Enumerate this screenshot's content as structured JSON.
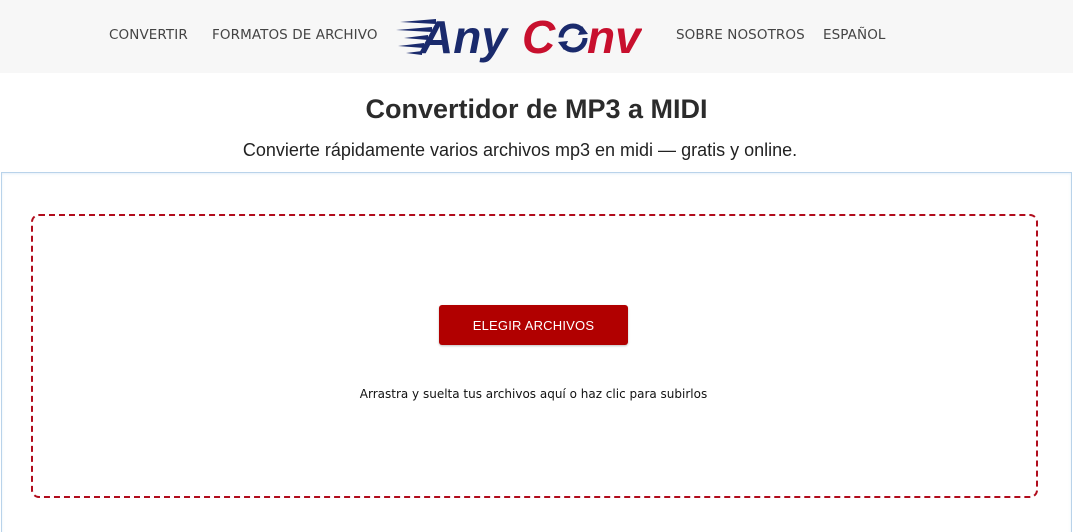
{
  "nav": {
    "convert": "CONVERTIR",
    "formats": "FORMATOS DE ARCHIVO",
    "about": "SOBRE NOSOTROS",
    "language": "ESPAÑOL"
  },
  "logo": {
    "text_any": "Any",
    "text_c": "C",
    "text_nv": "nv",
    "color_blue": "#1a2a6c",
    "color_red": "#c8102e"
  },
  "main": {
    "title": "Convertidor de MP3 a MIDI",
    "subtitle": "Convierte rápidamente varios archivos mp3 en midi — gratis y online."
  },
  "upload": {
    "button_label": "ELEGIR ARCHIVOS",
    "hint": "Arrastra y suelta tus archivos aquí o haz clic para subirlos"
  },
  "colors": {
    "accent": "#b10000",
    "dashed_border": "#b10c1c",
    "header_bg": "#f7f7f7"
  }
}
